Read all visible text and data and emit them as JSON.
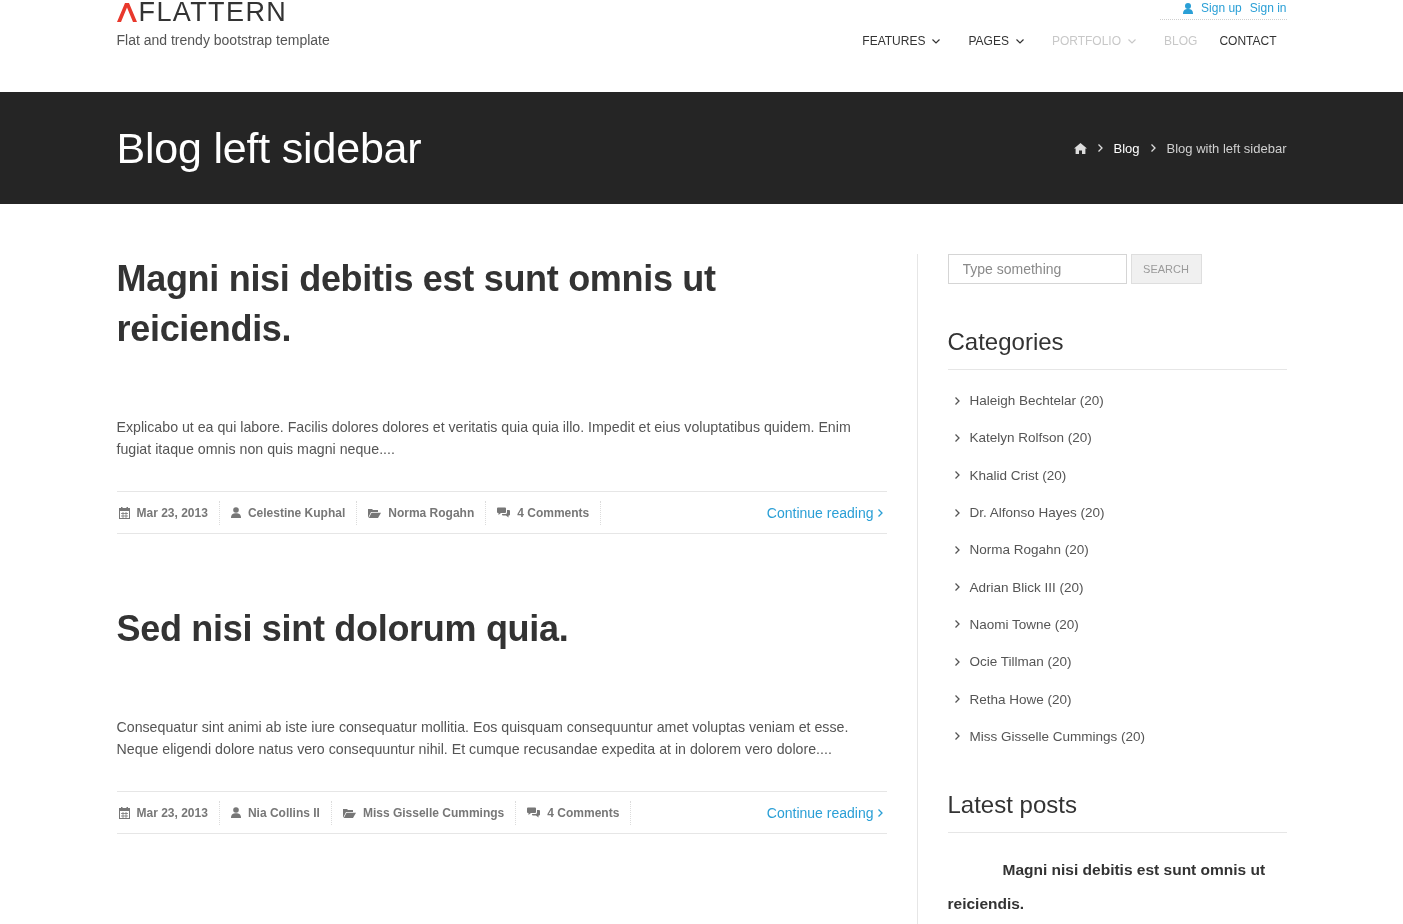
{
  "header": {
    "logo": {
      "text": "FLATTERN"
    },
    "tagline": "Flat and trendy bootstrap template",
    "account_links": [
      "Sign up",
      "Sign in"
    ],
    "nav": [
      {
        "label": "FEATURES",
        "has_dropdown": true,
        "dimmed": false
      },
      {
        "label": "PAGES",
        "has_dropdown": true,
        "dimmed": false
      },
      {
        "label": "PORTFOLIO",
        "has_dropdown": true,
        "dimmed": true
      },
      {
        "label": "BLOG",
        "has_dropdown": false,
        "dimmed": true
      },
      {
        "label": "CONTACT",
        "has_dropdown": false,
        "dimmed": false
      }
    ]
  },
  "banner": {
    "title": "Blog left sidebar",
    "breadcrumb": [
      {
        "label": "Blog",
        "current": false
      },
      {
        "label": "Blog with left sidebar",
        "current": true
      }
    ]
  },
  "posts": [
    {
      "title": "Magni nisi debitis est sunt omnis ut reiciendis.",
      "excerpt": "Explicabo ut ea qui labore. Facilis dolores dolores et veritatis quia quia illo. Impedit et eius voluptatibus quidem. Enim fugiat itaque omnis non quis magni neque....",
      "meta": [
        {
          "kind": "date",
          "text": "Mar 23, 2013"
        },
        {
          "kind": "author",
          "text": "Celestine Kuphal"
        },
        {
          "kind": "category",
          "text": "Norma Rogahn"
        },
        {
          "kind": "comments",
          "text": "4 Comments"
        }
      ],
      "more": "Continue reading"
    },
    {
      "title": "Sed nisi sint dolorum quia.",
      "excerpt": "Consequatur sint animi ab iste iure consequatur mollitia. Eos quisquam consequuntur amet voluptas veniam et esse. Neque eligendi dolore natus vero consequuntur nihil. Et cumque recusandae expedita at in dolorem vero dolore....",
      "meta": [
        {
          "kind": "date",
          "text": "Mar 23, 2013"
        },
        {
          "kind": "author",
          "text": "Nia Collins II"
        },
        {
          "kind": "category",
          "text": "Miss Gisselle Cummings"
        },
        {
          "kind": "comments",
          "text": "4 Comments"
        }
      ],
      "more": "Continue reading"
    }
  ],
  "sidebar": {
    "search": {
      "placeholder": "Type something",
      "button": "SEARCH"
    },
    "categories": {
      "title": "Categories",
      "items": [
        "Haleigh Bechtelar (20)",
        "Katelyn Rolfson (20)",
        "Khalid Crist (20)",
        "Dr. Alfonso Hayes (20)",
        "Norma Rogahn (20)",
        "Adrian Blick III (20)",
        "Naomi Towne (20)",
        "Ocie Tillman (20)",
        "Retha Howe (20)",
        "Miss Gisselle Cummings (20)"
      ]
    },
    "latest_posts": {
      "title": "Latest posts",
      "items": [
        "Magni nisi debitis est sunt omnis ut reiciendis."
      ]
    }
  }
}
